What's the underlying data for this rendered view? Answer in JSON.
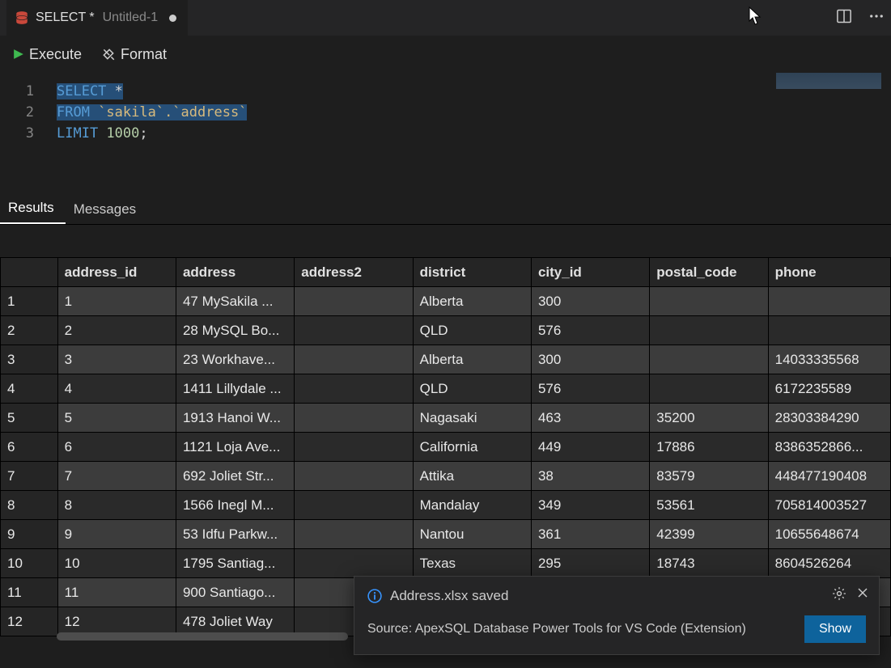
{
  "tab": {
    "title": "SELECT *",
    "subtitle": "Untitled-1",
    "dirty": true
  },
  "actionbar": {
    "execute": "Execute",
    "format": "Format"
  },
  "code": {
    "lines": [
      "1",
      "2",
      "3"
    ],
    "l1_kw": "SELECT",
    "l1_star": " *",
    "l2_kw": "FROM",
    "l2_ident": " `sakila`.`address`",
    "l3_kw": "LIMIT",
    "l3_num": " 1000",
    "l3_semi": ";"
  },
  "results_tabs": {
    "results": "Results",
    "messages": "Messages"
  },
  "columns": [
    "",
    "address_id",
    "address",
    "address2",
    "district",
    "city_id",
    "postal_code",
    "phone"
  ],
  "rows": [
    {
      "n": "1",
      "address_id": "1",
      "address": "47 MySakila ...",
      "address2": "",
      "district": "Alberta",
      "city_id": "300",
      "postal_code": "",
      "phone": ""
    },
    {
      "n": "2",
      "address_id": "2",
      "address": "28 MySQL Bo...",
      "address2": "",
      "district": "QLD",
      "city_id": "576",
      "postal_code": "",
      "phone": ""
    },
    {
      "n": "3",
      "address_id": "3",
      "address": "23 Workhave...",
      "address2": "",
      "district": "Alberta",
      "city_id": "300",
      "postal_code": "",
      "phone": "14033335568"
    },
    {
      "n": "4",
      "address_id": "4",
      "address": "1411 Lillydale ...",
      "address2": "",
      "district": "QLD",
      "city_id": "576",
      "postal_code": "",
      "phone": "6172235589"
    },
    {
      "n": "5",
      "address_id": "5",
      "address": "1913 Hanoi W...",
      "address2": "",
      "district": "Nagasaki",
      "city_id": "463",
      "postal_code": "35200",
      "phone": "28303384290"
    },
    {
      "n": "6",
      "address_id": "6",
      "address": "1121 Loja Ave...",
      "address2": "",
      "district": "California",
      "city_id": "449",
      "postal_code": "17886",
      "phone": "8386352866..."
    },
    {
      "n": "7",
      "address_id": "7",
      "address": "692 Joliet Str...",
      "address2": "",
      "district": "Attika",
      "city_id": "38",
      "postal_code": "83579",
      "phone": "448477190408"
    },
    {
      "n": "8",
      "address_id": "8",
      "address": "1566 Inegl M...",
      "address2": "",
      "district": "Mandalay",
      "city_id": "349",
      "postal_code": "53561",
      "phone": "705814003527"
    },
    {
      "n": "9",
      "address_id": "9",
      "address": "53 Idfu Parkw...",
      "address2": "",
      "district": "Nantou",
      "city_id": "361",
      "postal_code": "42399",
      "phone": "10655648674"
    },
    {
      "n": "10",
      "address_id": "10",
      "address": "1795 Santiag...",
      "address2": "",
      "district": "Texas",
      "city_id": "295",
      "postal_code": "18743",
      "phone": "8604526264"
    },
    {
      "n": "11",
      "address_id": "11",
      "address": "900 Santiago...",
      "address2": "",
      "district": "",
      "city_id": "",
      "postal_code": "",
      "phone": ""
    },
    {
      "n": "12",
      "address_id": "12",
      "address": "478 Joliet Way",
      "address2": "",
      "district": "",
      "city_id": "",
      "postal_code": "",
      "phone": ""
    }
  ],
  "toast": {
    "title": "Address.xlsx saved",
    "source": "Source: ApexSQL Database Power Tools for VS Code (Extension)",
    "button": "Show"
  }
}
